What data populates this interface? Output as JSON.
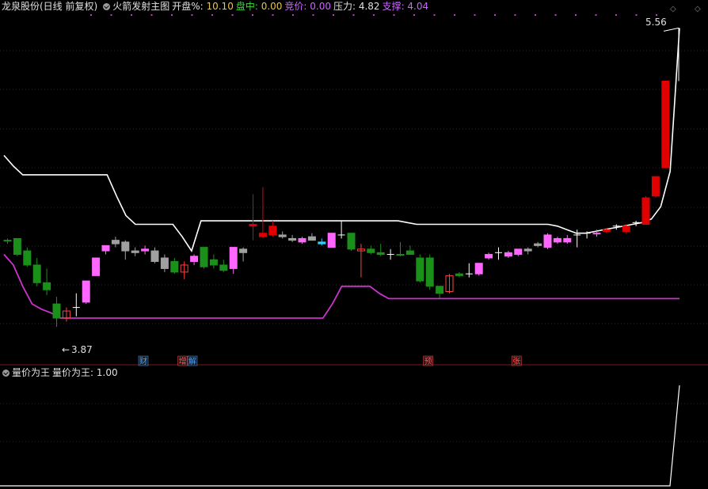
{
  "header": {
    "stock_title": "龙泉股份(日线 前复权)",
    "indicator_name": "火箭发射主图",
    "open_pct_label": "开盘%: ",
    "open_pct_value": "10.10",
    "intraday_label": "盘中: ",
    "intraday_value": "0.00",
    "bid_label": "竞价: ",
    "bid_value": "0.00",
    "resist_label": "压力: ",
    "resist_value": "4.82",
    "support_label": "支撑: ",
    "support_value": "4.04"
  },
  "subheader": {
    "indicator_name": "量价为王",
    "value_label": "量价为王: ",
    "value": "1.00"
  },
  "top_right_icons": [
    "diamond-icon",
    "diamond-icon"
  ],
  "markers": {
    "high_label": "5.56",
    "low_label": "3.87",
    "low_arrow": "←",
    "event_tags": [
      {
        "text": "财",
        "color": "#4aa3ff",
        "index": 5
      },
      {
        "text": "增",
        "color": "#ff5050",
        "index": 9
      },
      {
        "text": "解",
        "color": "#4aa3ff",
        "index": 10
      },
      {
        "text": "预",
        "color": "#ff5050",
        "index": 34
      },
      {
        "text": "张",
        "color": "#ff5050",
        "index": 43
      }
    ]
  },
  "colors": {
    "up_pink": "#ff66ff",
    "up_red": "#e00000",
    "down_green": "#008000",
    "down_green_fill": "#1a8f1a",
    "gray": "#a0a0a0",
    "cyan": "#33ccff",
    "white_line": "#ffffff",
    "magenta_line": "#cc33cc",
    "grid": "#3a1a1a",
    "header_yellow": "#e8c44a",
    "header_purple": "#cc66ff",
    "header_green": "#33dd33"
  },
  "chart_data": {
    "type": "candlestick",
    "title": "龙泉股份(日线 前复权)",
    "price_range": [
      3.75,
      5.62
    ],
    "high_price": 5.56,
    "low_price": 3.87,
    "series": [
      {
        "name": "火箭发射主图 white line",
        "values": [
          4.84,
          4.78,
          4.73,
          4.73,
          4.73,
          4.73,
          4.73,
          4.73,
          4.73,
          4.73,
          4.73,
          4.73,
          4.61,
          4.5,
          4.45,
          4.45,
          4.45,
          4.45,
          4.45,
          4.38,
          4.3,
          4.47,
          4.47,
          4.47,
          4.47,
          4.47,
          4.47,
          4.47,
          4.47,
          4.47,
          4.47,
          4.47,
          4.47,
          4.47,
          4.47,
          4.47,
          4.47,
          4.47,
          4.47,
          4.47,
          4.47,
          4.47,
          4.47,
          4.46,
          4.45,
          4.45,
          4.45,
          4.45,
          4.45,
          4.45,
          4.45,
          4.45,
          4.45,
          4.45,
          4.45,
          4.45,
          4.45,
          4.45,
          4.45,
          4.44,
          4.42,
          4.4,
          4.4,
          4.41,
          4.42,
          4.43,
          4.44,
          4.45,
          4.46,
          4.48,
          4.55,
          4.75,
          5.56
        ]
      },
      {
        "name": "火箭发射主图 magenta line",
        "values": [
          4.28,
          4.22,
          4.1,
          4.0,
          3.97,
          3.95,
          3.92,
          3.92,
          3.92,
          3.92,
          3.92,
          3.92,
          3.92,
          3.92,
          3.92,
          3.92,
          3.92,
          3.92,
          3.92,
          3.92,
          3.92,
          3.92,
          3.92,
          3.92,
          3.92,
          3.92,
          3.92,
          3.92,
          3.92,
          3.92,
          3.92,
          3.92,
          3.92,
          3.92,
          3.92,
          4.0,
          4.1,
          4.1,
          4.1,
          4.1,
          4.06,
          4.03,
          4.03,
          4.03,
          4.03,
          4.03,
          4.03,
          4.03,
          4.03,
          4.03,
          4.03,
          4.03,
          4.03,
          4.03,
          4.03,
          4.03,
          4.03,
          4.03,
          4.03,
          4.03,
          4.03,
          4.03,
          4.03,
          4.03,
          4.03,
          4.03,
          4.03,
          4.03,
          4.03,
          4.03,
          4.03,
          4.03,
          4.03
        ]
      }
    ],
    "candles": [
      {
        "o": 4.36,
        "h": 4.37,
        "l": 4.34,
        "c": 4.36,
        "k": "green"
      },
      {
        "o": 4.37,
        "h": 4.37,
        "l": 4.27,
        "c": 4.28,
        "k": "green"
      },
      {
        "o": 4.3,
        "h": 4.32,
        "l": 4.21,
        "c": 4.22,
        "k": "green"
      },
      {
        "o": 4.22,
        "h": 4.26,
        "l": 4.1,
        "c": 4.12,
        "k": "green"
      },
      {
        "o": 4.12,
        "h": 4.2,
        "l": 4.05,
        "c": 4.08,
        "k": "green"
      },
      {
        "o": 4.0,
        "h": 4.04,
        "l": 3.87,
        "c": 3.92,
        "k": "green"
      },
      {
        "o": 3.92,
        "h": 3.98,
        "l": 3.9,
        "c": 3.96,
        "k": "outline"
      },
      {
        "o": 3.98,
        "h": 4.06,
        "l": 3.93,
        "c": 3.98,
        "k": "cross"
      },
      {
        "o": 4.01,
        "h": 4.13,
        "l": 4.0,
        "c": 4.13,
        "k": "pink"
      },
      {
        "o": 4.16,
        "h": 4.26,
        "l": 4.16,
        "c": 4.26,
        "k": "pink"
      },
      {
        "o": 4.3,
        "h": 4.33,
        "l": 4.28,
        "c": 4.33,
        "k": "pink"
      },
      {
        "o": 4.34,
        "h": 4.38,
        "l": 4.32,
        "c": 4.36,
        "k": "gray"
      },
      {
        "o": 4.35,
        "h": 4.36,
        "l": 4.25,
        "c": 4.3,
        "k": "gray"
      },
      {
        "o": 4.3,
        "h": 4.32,
        "l": 4.27,
        "c": 4.29,
        "k": "gray"
      },
      {
        "o": 4.31,
        "h": 4.33,
        "l": 4.28,
        "c": 4.3,
        "k": "pink"
      },
      {
        "o": 4.3,
        "h": 4.32,
        "l": 4.23,
        "c": 4.24,
        "k": "gray"
      },
      {
        "o": 4.26,
        "h": 4.28,
        "l": 4.18,
        "c": 4.2,
        "k": "gray"
      },
      {
        "o": 4.24,
        "h": 4.26,
        "l": 4.17,
        "c": 4.18,
        "k": "green"
      },
      {
        "o": 4.18,
        "h": 4.24,
        "l": 4.14,
        "c": 4.22,
        "k": "outline"
      },
      {
        "o": 4.24,
        "h": 4.28,
        "l": 4.22,
        "c": 4.27,
        "k": "pink"
      },
      {
        "o": 4.32,
        "h": 4.32,
        "l": 4.2,
        "c": 4.21,
        "k": "green"
      },
      {
        "o": 4.25,
        "h": 4.28,
        "l": 4.2,
        "c": 4.22,
        "k": "green"
      },
      {
        "o": 4.22,
        "h": 4.25,
        "l": 4.18,
        "c": 4.19,
        "k": "green"
      },
      {
        "o": 4.2,
        "h": 4.32,
        "l": 4.17,
        "c": 4.32,
        "k": "pink"
      },
      {
        "o": 4.29,
        "h": 4.32,
        "l": 4.24,
        "c": 4.31,
        "k": "gray"
      },
      {
        "o": 4.44,
        "h": 4.62,
        "l": 4.36,
        "c": 4.45,
        "k": "red"
      },
      {
        "o": 4.38,
        "h": 4.66,
        "l": 4.37,
        "c": 4.4,
        "k": "red"
      },
      {
        "o": 4.39,
        "h": 4.47,
        "l": 4.38,
        "c": 4.44,
        "k": "red"
      },
      {
        "o": 4.39,
        "h": 4.41,
        "l": 4.37,
        "c": 4.38,
        "k": "gray"
      },
      {
        "o": 4.36,
        "h": 4.39,
        "l": 4.35,
        "c": 4.37,
        "k": "gray"
      },
      {
        "o": 4.35,
        "h": 4.38,
        "l": 4.34,
        "c": 4.37,
        "k": "pink"
      },
      {
        "o": 4.38,
        "h": 4.4,
        "l": 4.36,
        "c": 4.36,
        "k": "gray"
      },
      {
        "o": 4.35,
        "h": 4.37,
        "l": 4.33,
        "c": 4.34,
        "k": "cyan"
      },
      {
        "o": 4.32,
        "h": 4.4,
        "l": 4.32,
        "c": 4.4,
        "k": "pink"
      },
      {
        "o": 4.38,
        "h": 4.47,
        "l": 4.37,
        "c": 4.39,
        "k": "cross"
      },
      {
        "o": 4.4,
        "h": 4.4,
        "l": 4.3,
        "c": 4.31,
        "k": "green"
      },
      {
        "o": 4.3,
        "h": 4.34,
        "l": 4.15,
        "c": 4.31,
        "k": "outline"
      },
      {
        "o": 4.31,
        "h": 4.33,
        "l": 4.28,
        "c": 4.29,
        "k": "green"
      },
      {
        "o": 4.29,
        "h": 4.34,
        "l": 4.27,
        "c": 4.28,
        "k": "green"
      },
      {
        "o": 4.28,
        "h": 4.31,
        "l": 4.25,
        "c": 4.28,
        "k": "cross"
      },
      {
        "o": 4.28,
        "h": 4.35,
        "l": 4.27,
        "c": 4.28,
        "k": "green"
      },
      {
        "o": 4.3,
        "h": 4.33,
        "l": 4.28,
        "c": 4.28,
        "k": "green"
      },
      {
        "o": 4.26,
        "h": 4.28,
        "l": 4.12,
        "c": 4.13,
        "k": "green"
      },
      {
        "o": 4.26,
        "h": 4.28,
        "l": 4.08,
        "c": 4.1,
        "k": "green"
      },
      {
        "o": 4.1,
        "h": 4.1,
        "l": 4.03,
        "c": 4.06,
        "k": "green"
      },
      {
        "o": 4.07,
        "h": 4.17,
        "l": 4.06,
        "c": 4.16,
        "k": "outline"
      },
      {
        "o": 4.17,
        "h": 4.18,
        "l": 4.15,
        "c": 4.16,
        "k": "green"
      },
      {
        "o": 4.16,
        "h": 4.23,
        "l": 4.15,
        "c": 4.17,
        "k": "cross"
      },
      {
        "o": 4.17,
        "h": 4.23,
        "l": 4.16,
        "c": 4.23,
        "k": "pink"
      },
      {
        "o": 4.26,
        "h": 4.29,
        "l": 4.25,
        "c": 4.28,
        "k": "pink"
      },
      {
        "o": 4.26,
        "h": 4.32,
        "l": 4.25,
        "c": 4.29,
        "k": "cross"
      },
      {
        "o": 4.27,
        "h": 4.3,
        "l": 4.26,
        "c": 4.29,
        "k": "pink"
      },
      {
        "o": 4.28,
        "h": 4.31,
        "l": 4.27,
        "c": 4.31,
        "k": "pink"
      },
      {
        "o": 4.3,
        "h": 4.32,
        "l": 4.28,
        "c": 4.31,
        "k": "gray"
      },
      {
        "o": 4.33,
        "h": 4.35,
        "l": 4.32,
        "c": 4.34,
        "k": "gray"
      },
      {
        "o": 4.32,
        "h": 4.4,
        "l": 4.31,
        "c": 4.39,
        "k": "pink"
      },
      {
        "o": 4.35,
        "h": 4.38,
        "l": 4.34,
        "c": 4.37,
        "k": "pink"
      },
      {
        "o": 4.35,
        "h": 4.39,
        "l": 4.34,
        "c": 4.37,
        "k": "pink"
      },
      {
        "o": 4.38,
        "h": 4.42,
        "l": 4.32,
        "c": 4.39,
        "k": "cross"
      },
      {
        "o": 4.4,
        "h": 4.41,
        "l": 4.37,
        "c": 4.4,
        "k": "cross"
      },
      {
        "o": 4.4,
        "h": 4.42,
        "l": 4.38,
        "c": 4.4,
        "k": "pink"
      },
      {
        "o": 4.41,
        "h": 4.43,
        "l": 4.4,
        "c": 4.42,
        "k": "red"
      },
      {
        "o": 4.43,
        "h": 4.45,
        "l": 4.42,
        "c": 4.44,
        "k": "cross"
      },
      {
        "o": 4.41,
        "h": 4.45,
        "l": 4.4,
        "c": 4.44,
        "k": "red"
      },
      {
        "o": 4.45,
        "h": 4.47,
        "l": 4.44,
        "c": 4.46,
        "k": "cross"
      },
      {
        "o": 4.45,
        "h": 4.61,
        "l": 4.45,
        "c": 4.6,
        "k": "red"
      },
      {
        "o": 4.61,
        "h": 4.72,
        "l": 4.6,
        "c": 4.72,
        "k": "red"
      },
      {
        "o": 4.77,
        "h": 5.26,
        "l": 4.77,
        "c": 5.26,
        "k": "red"
      }
    ]
  }
}
